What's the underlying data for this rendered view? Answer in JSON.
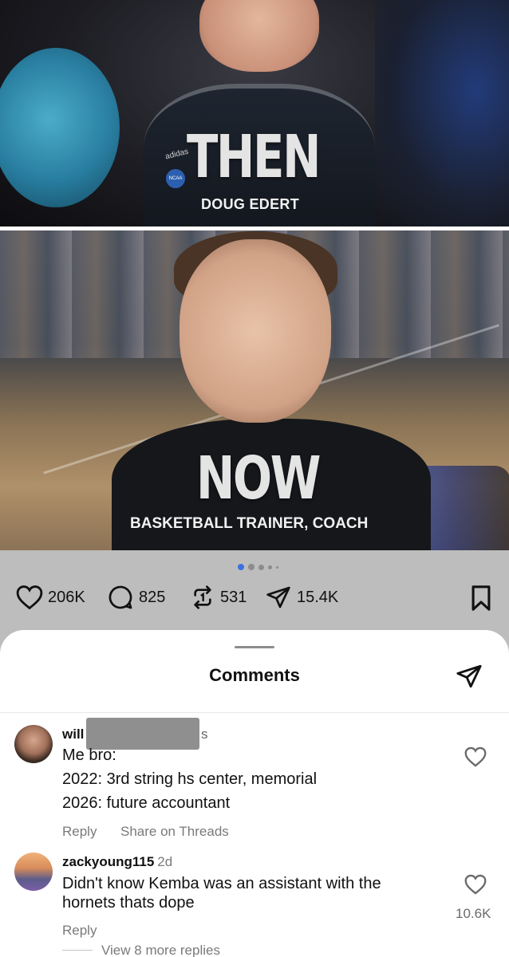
{
  "post": {
    "then_label": "THEN",
    "then_name": "DOUG EDERT",
    "brand_text": "adidas",
    "badge_text": "NCAA",
    "now_label": "NOW",
    "now_title": "BASKETBALL TRAINER, COACH",
    "carousel": {
      "total_dots": 5,
      "active_index": 0
    }
  },
  "actions": {
    "likes": "206K",
    "comments": "825",
    "reposts": "531",
    "shares": "15.4K"
  },
  "sheet": {
    "title": "Comments"
  },
  "comments": [
    {
      "username_visible": "will",
      "username_tail": "s",
      "lines": [
        "Me bro:",
        "2022: 3rd string hs center, memorial",
        "2026: future accountant"
      ],
      "reply_label": "Reply",
      "share_label": "Share on Threads"
    },
    {
      "username": "zackyoung115",
      "time": "2d",
      "lines": [
        "Didn't know Kemba was an assistant with the",
        "hornets thats dope"
      ],
      "reply_label": "Reply",
      "likes": "10.6K",
      "view_replies": "View 8 more replies"
    }
  ],
  "colors": {
    "accent_dot": "#3d6fe0",
    "dimmed_bar": "#bdbdbd",
    "secondary_text": "#7a7a7a"
  },
  "icons": [
    "heart-icon",
    "comment-icon",
    "repost-icon",
    "send-icon",
    "bookmark-icon",
    "share-icon"
  ]
}
